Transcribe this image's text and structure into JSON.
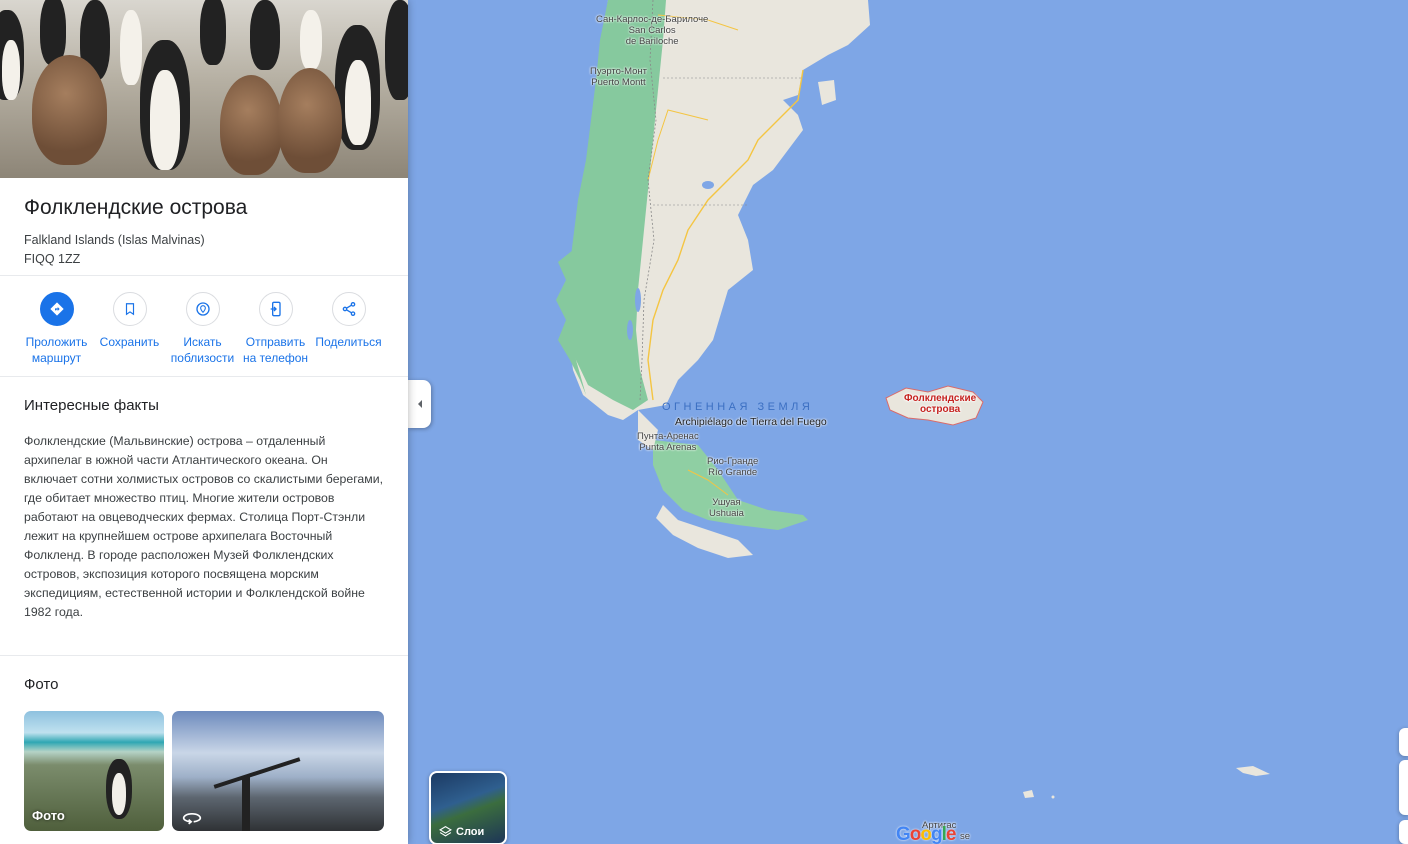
{
  "panel": {
    "hero_alt": "",
    "title": "Фолклендские острова",
    "subtitle_line1": "Falkland Islands (Islas Malvinas)",
    "subtitle_line2": "FIQQ 1ZZ",
    "actions": [
      {
        "label": "Проложить\nмаршрут",
        "icon": "directions-icon"
      },
      {
        "label": "Сохранить",
        "icon": "bookmark-icon"
      },
      {
        "label": "Искать\nпоблизости",
        "icon": "nearby-icon"
      },
      {
        "label": "Отправить\nна телефон",
        "icon": "send-to-phone-icon"
      },
      {
        "label": "Поделиться",
        "icon": "share-icon"
      }
    ],
    "facts_title": "Интересные факты",
    "facts_text": "Фолклендские (Мальвинские) острова – отдаленный архипелаг в южной части Атлантического океана. Он включает сотни холмистых островов со скалистыми берегами, где обитает множество птиц. Многие жители островов работают на овцеводческих фермах. Столица Порт-Стэнли лежит на крупнейшем острове архипелага Восточный Фолкленд. В городе расположен Музей Фолклендских островов, экспозиция которого посвящена морским экспедициям, естественной истории и Фолклендской войне 1982 года.",
    "photos_title": "Фото",
    "photos": [
      {
        "caption": "Фото"
      },
      {
        "caption": ""
      }
    ]
  },
  "map": {
    "labels": {
      "bariloche": "Сан-Карлос-де-Барилоче\nSan Carlos\nde Bariloche",
      "puerto_montt": "Пуэрто-Монт\nPuerto Montt",
      "tierra_region": "ОГНЕННАЯ ЗЕМЛЯ",
      "tierra_arch": "Archipiélago de Tierra del Fuego",
      "punta_arenas": "Пунта-Аренас\nPunta Arenas",
      "rio_grande": "Рио-Гранде\nRío Grande",
      "ushuaia": "Ушуая\nUshuaia",
      "falklands": "Фолклендские\nострова",
      "artigas": "Артигас",
      "se": "se"
    },
    "layers_label": "Слои",
    "google_logo": "Google",
    "colors": {
      "water": "#7ea6e6",
      "land": "#e8e5dc",
      "forest": "#7fc79a",
      "accent": "#1a73e8",
      "falkland_label": "#c5221f"
    }
  }
}
